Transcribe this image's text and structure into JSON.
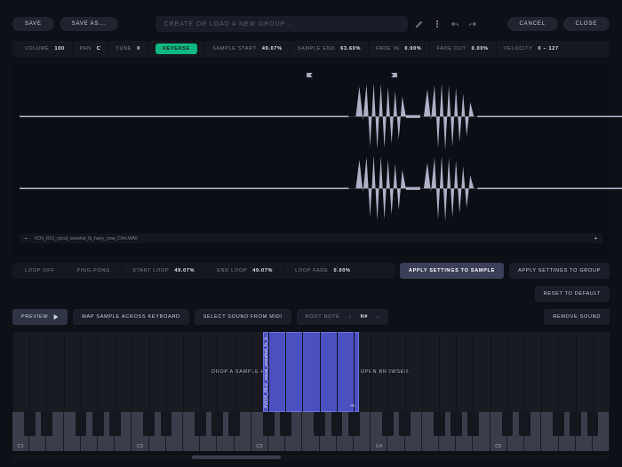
{
  "header": {
    "save": "SAVE",
    "save_as": "SAVE AS...",
    "search_placeholder": "CREATE OR LOAD A NEW GROUP...",
    "cancel": "CANCEL",
    "close": "CLOSE"
  },
  "params": {
    "volume_label": "VOLUME",
    "volume_val": "100",
    "pan_label": "PAN",
    "pan_val": "C",
    "tune_label": "TUNE",
    "tune_val": "0",
    "reverse": "REVERSE",
    "sample_start_label": "SAMPLE START",
    "sample_start_val": "49.07%",
    "sample_end_label": "SAMPLE END",
    "sample_end_val": "63.60%",
    "fade_in_label": "FADE IN",
    "fade_in_val": "0.00%",
    "fade_out_label": "FADE OUT",
    "fade_out_val": "0.00%",
    "velocity_label": "VELOCITY",
    "velocity_val": "0   –   127"
  },
  "waveform": {
    "filename": "VOX_RLV_vocal_oneshot_fx_hurry_now_C#m.WAV",
    "flags": {
      "start_pct": 49.07,
      "end_pct": 63.6
    }
  },
  "loop": {
    "loop_off": "LOOP OFF",
    "ping_pong": "PING-PONG",
    "start_loop_label": "START LOOP",
    "start_loop_val": "49.07%",
    "end_loop_label": "END LOOP",
    "end_loop_val": "49.07%",
    "loop_fade_label": "LOOP FADE",
    "loop_fade_val": "0.00%",
    "apply_sample": "APPLY SETTINGS TO SAMPLE",
    "apply_group": "APPLY SETTINGS TO GROUP",
    "reset": "RESET TO DEFAULT"
  },
  "mid": {
    "preview": "PREVIEW",
    "map_keyboard": "MAP SAMPLE ACROSS KEYBOARD",
    "select_midi": "SELECT SOUND FROM MIDI",
    "root_note_label": "ROOT NOTE",
    "root_note_val": "H#",
    "remove_sound": "REMOVE SOUND"
  },
  "keyboard": {
    "drop_hint": "DROP A SAMPLE HERE OR PRESS RIGHT CLICK TO OPEN BROWSER.",
    "sample_label": "#VOX_RLV_vocal_oneshot_fx_h...",
    "sample_span": {
      "left_pct": 42.0,
      "width_pct": 16.0
    },
    "c_labels": [
      "C1",
      "C2",
      "C3",
      "C4",
      "C5"
    ],
    "white_keys": 35,
    "scroll_thumb": {
      "left_pct": 30,
      "width_pct": 15
    }
  },
  "colors": {
    "accent_green": "#10b981",
    "sample_block": "#4b50c0"
  }
}
